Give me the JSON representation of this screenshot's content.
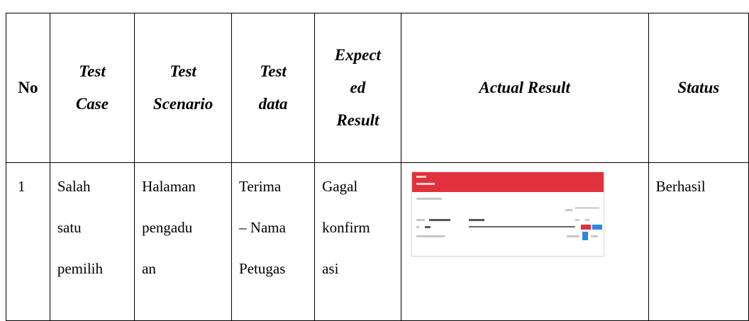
{
  "table": {
    "headers": {
      "no": "No",
      "test_case": "Test\nCase",
      "test_scenario": "Test\nScenario",
      "test_data": "Test\ndata",
      "expected_result": "Expect\ned\nResult",
      "actual_result": "Actual Result",
      "status": "Status"
    },
    "rows": [
      {
        "no": "1",
        "test_case": "Salah\nsatu\npemilih",
        "test_scenario": "Halaman\npengadu\nan",
        "test_data": "Terima\n– Nama\nPetugas",
        "expected_result": "Gagal\nkonfirm\nasi",
        "status": "Berhasil"
      }
    ]
  },
  "colors": {
    "screenshot_header": "#e0313c",
    "screenshot_button_blue": "#2c88e0"
  }
}
